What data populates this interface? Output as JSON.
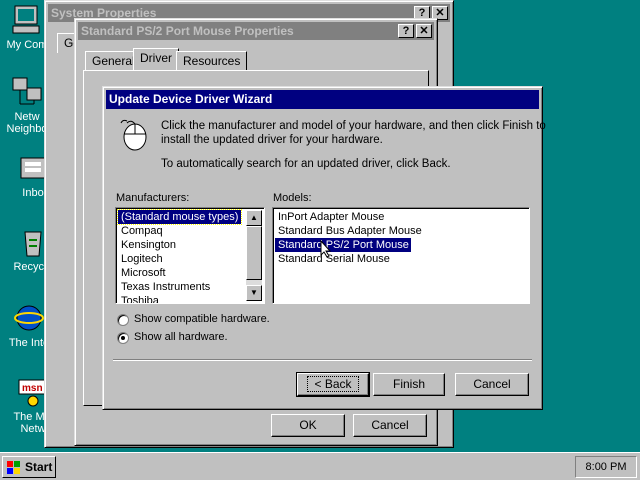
{
  "desktop": {
    "icons": [
      {
        "label": "My Com"
      },
      {
        "label": "Netw Neighbo",
        "line1": "Netw",
        "line2": "Neighbo"
      },
      {
        "label": "Inbo"
      },
      {
        "label": "Recycle"
      },
      {
        "label": "The Inte"
      },
      {
        "label": "The Mic Netw",
        "line1": "The Mic",
        "line2": "Netw"
      }
    ]
  },
  "system_properties": {
    "title": "System Properties",
    "help_btn": "?",
    "close_btn": "✕",
    "tab_partial": "Ge"
  },
  "mouse_properties": {
    "title": "Standard PS/2 Port Mouse Properties",
    "help_btn": "?",
    "close_btn": "✕",
    "tabs": [
      "General",
      "Driver",
      "Resources"
    ],
    "ok_label": "OK",
    "cancel_label": "Cancel"
  },
  "wizard": {
    "title": "Update Device Driver Wizard",
    "instruction_line1": "Click the manufacturer and model of your hardware, and then click Finish to",
    "instruction_line2": "install the updated driver for your hardware.",
    "auto_search": "To automatically search for an updated driver, click Back.",
    "manufacturers_label": "Manufacturers:",
    "models_label": "Models:",
    "manufacturers": [
      "(Standard mouse types)",
      "Compaq",
      "Kensington",
      "Logitech",
      "Microsoft",
      "Texas Instruments",
      "Toshiba"
    ],
    "selected_manufacturer": "(Standard mouse types)",
    "models": [
      "InPort Adapter Mouse",
      "Standard Bus Adapter Mouse",
      "Standard PS/2 Port Mouse",
      "Standard Serial Mouse"
    ],
    "selected_model": "Standard PS/2 Port Mouse",
    "radio_compatible": "Show compatible hardware.",
    "radio_all": "Show all hardware.",
    "radio_selected": "all",
    "back_label": "< Back",
    "finish_label": "Finish",
    "cancel_label": "Cancel"
  },
  "taskbar": {
    "start_label": "Start",
    "clock": "8:00 PM"
  }
}
